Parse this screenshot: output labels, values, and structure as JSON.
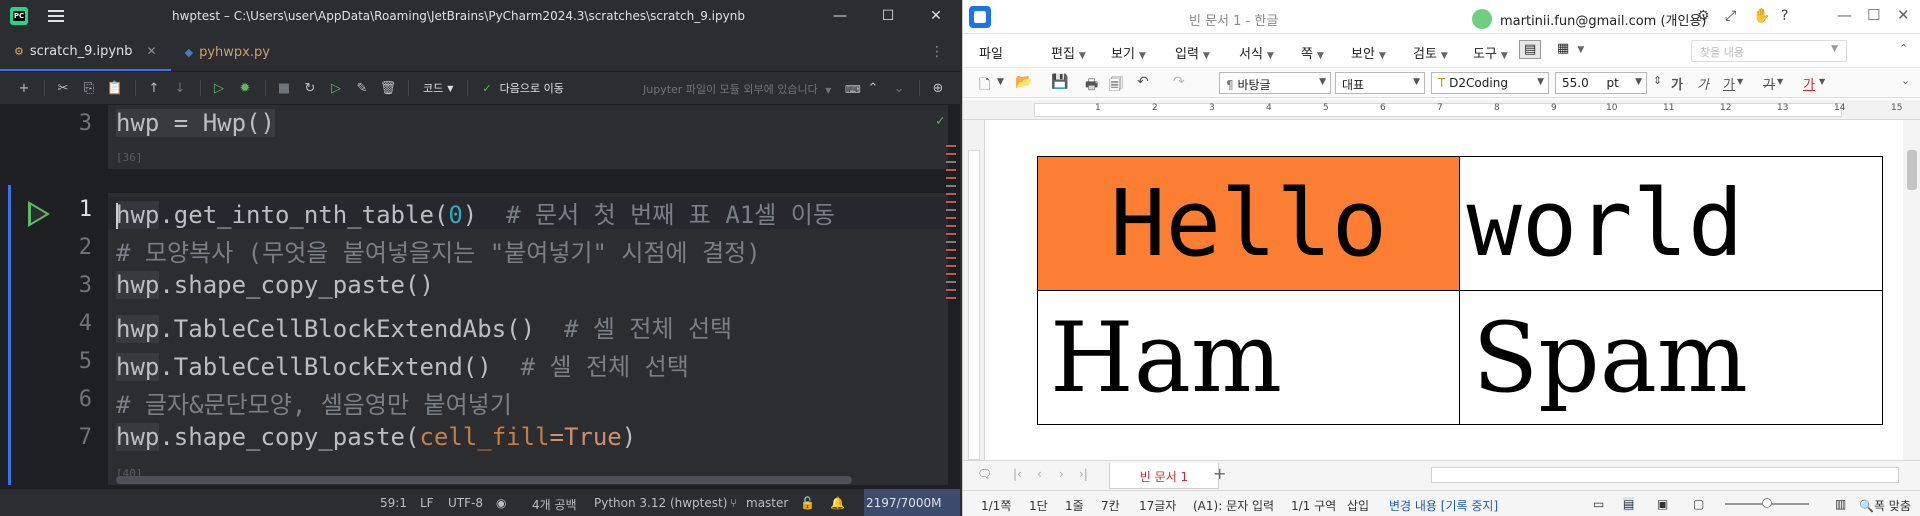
{
  "ide": {
    "title": "hwptest – C:\\Users\\user\\AppData\\Roaming\\JetBrains\\PyCharm2024.3\\scratches\\scratch_9.ipynb",
    "tabs": [
      {
        "label": "scratch_9.ipynb"
      },
      {
        "label": "pyhwpx.py"
      }
    ],
    "toolbar": {
      "cell_type": "코드",
      "goto_next": "다음으로 이동",
      "jupyter_status": "Jupyter 파일이 모듈 외부에 있습니다"
    },
    "prev_cell": {
      "line_number": "3",
      "code": "hwp = Hwp()",
      "exec_count": "[36]"
    },
    "cur_cell": {
      "line_numbers": [
        "1",
        "2",
        "3",
        "4",
        "5",
        "6",
        "7"
      ],
      "lines": {
        "l1_obj": "hwp",
        "l1_call": ".get_into_nth_table(",
        "l1_num": "0",
        "l1_close": ")",
        "l1_cmt": "  # 문서 첫 번째 표 A1셀 이동",
        "l2_cmt": "# 모양복사 (무엇을 붙여넣을지는 \"붙여넣기\" 시점에 결정)",
        "l3_obj": "hwp",
        "l3_rest": ".shape_copy_paste()",
        "l4_obj": "hwp",
        "l4_rest": ".TableCellBlockExtendAbs()",
        "l4_cmt": "  # 셀 전체 선택",
        "l5_obj": "hwp",
        "l5_rest": ".TableCellBlockExtend()",
        "l5_cmt": "  # 셀 전체 선택",
        "l6_cmt": "# 글자&문단모양, 셀음영만 붙여넣기",
        "l7_obj": "hwp",
        "l7_call": ".shape_copy_paste(",
        "l7_param": "cell_fill",
        "l7_eq": "=",
        "l7_true": "True",
        "l7_close": ")"
      },
      "exec_count": "[40]"
    },
    "status": {
      "position": "59:1",
      "line_sep": "LF",
      "encoding": "UTF-8",
      "indent": "4개 공백",
      "interpreter": "Python 3.12 (hwptest)",
      "branch": "master",
      "memory": "2197/7000M"
    }
  },
  "hwp": {
    "doc_title": "빈 문서 1 - 한글",
    "user": "martinii.fun@gmail.com (개인용)",
    "menu": [
      "파일",
      "편집",
      "보기",
      "입력",
      "서식",
      "쪽",
      "보안",
      "검토",
      "도구"
    ],
    "search_placeholder": "찾을 내용",
    "format": {
      "style": "바탕글",
      "lang": "대표",
      "font": "D2Coding",
      "size": "55.0",
      "unit": "pt",
      "char_bold": "가",
      "char_italic": "가",
      "char_underline": "가",
      "char_strike": "가",
      "char_color": "가"
    },
    "ruler_numbers": [
      "1",
      "2",
      "3",
      "4",
      "5",
      "6",
      "7",
      "8",
      "9",
      "10",
      "11",
      "12",
      "13",
      "14",
      "15"
    ],
    "table": {
      "a1": "Hello",
      "b1": "world",
      "a2": "Ham",
      "b2": "Spam",
      "a1_fill": "#fc7e32"
    },
    "doc_tab": "빈 문서 1",
    "status": {
      "page": "1/1쪽",
      "column": "1단",
      "line": "1줄",
      "col": "7칸",
      "chars": "17글자",
      "cell_mode": "(A1): 문자 입력",
      "section": "1/1 구역",
      "insert": "삽입",
      "track": "변경 내용 [기록 중지]",
      "zoom": "폭 맞춤"
    }
  }
}
